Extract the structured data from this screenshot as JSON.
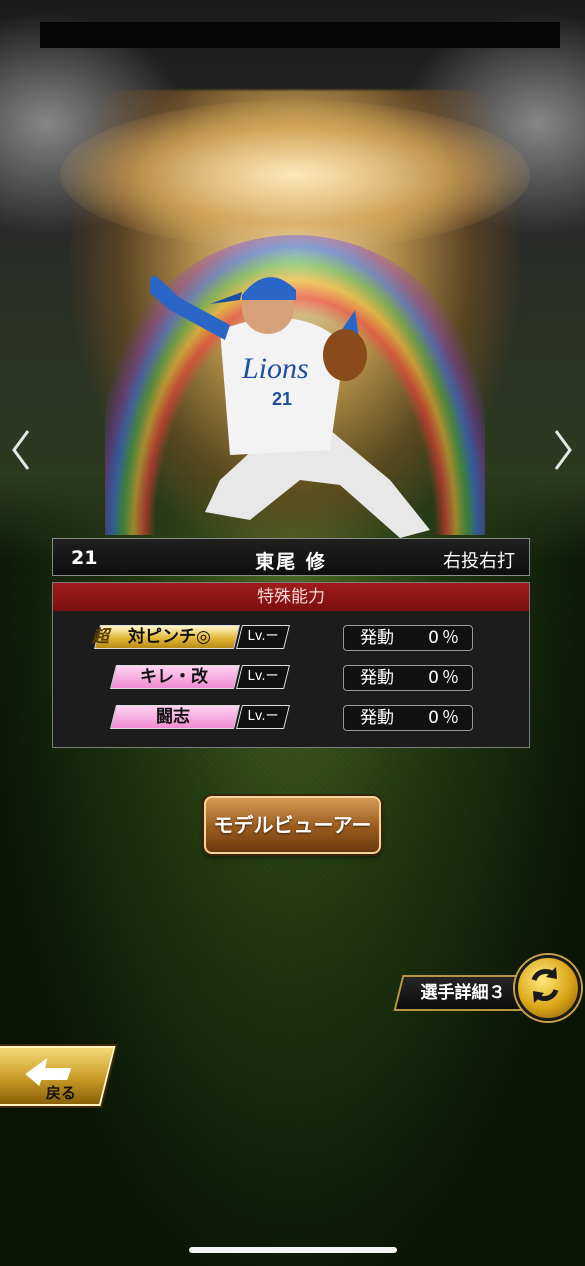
{
  "player": {
    "number": "21",
    "name": "東尾 修",
    "handedness": "右投右打",
    "jersey_team": "Lions",
    "jersey_number": "21"
  },
  "abilities": {
    "header": "特殊能力",
    "items": [
      {
        "badge": "超",
        "name": "対ピンチ◎",
        "level": "Lv.ー",
        "trigger_label": "発動",
        "trigger_rate": "0％",
        "style": "gold"
      },
      {
        "badge": "",
        "name": "キレ・改",
        "level": "Lv.ー",
        "trigger_label": "発動",
        "trigger_rate": "0％",
        "style": "pink"
      },
      {
        "badge": "",
        "name": "闘志",
        "level": "Lv.ー",
        "trigger_label": "発動",
        "trigger_rate": "0％",
        "style": "pink"
      }
    ]
  },
  "buttons": {
    "model_viewer": "モデルビューアー",
    "player_detail": "選手詳細３",
    "back": "戻る"
  },
  "icons": {
    "prev": "chevron-left-icon",
    "next": "chevron-right-icon",
    "cycle": "cycle-arrows-icon",
    "back": "back-arrow-icon"
  },
  "colors": {
    "ability_header": "#8c1414",
    "gold_skill": "#e2b838",
    "pink_skill": "#ef8bd2",
    "button_gold": "#c99a26"
  }
}
